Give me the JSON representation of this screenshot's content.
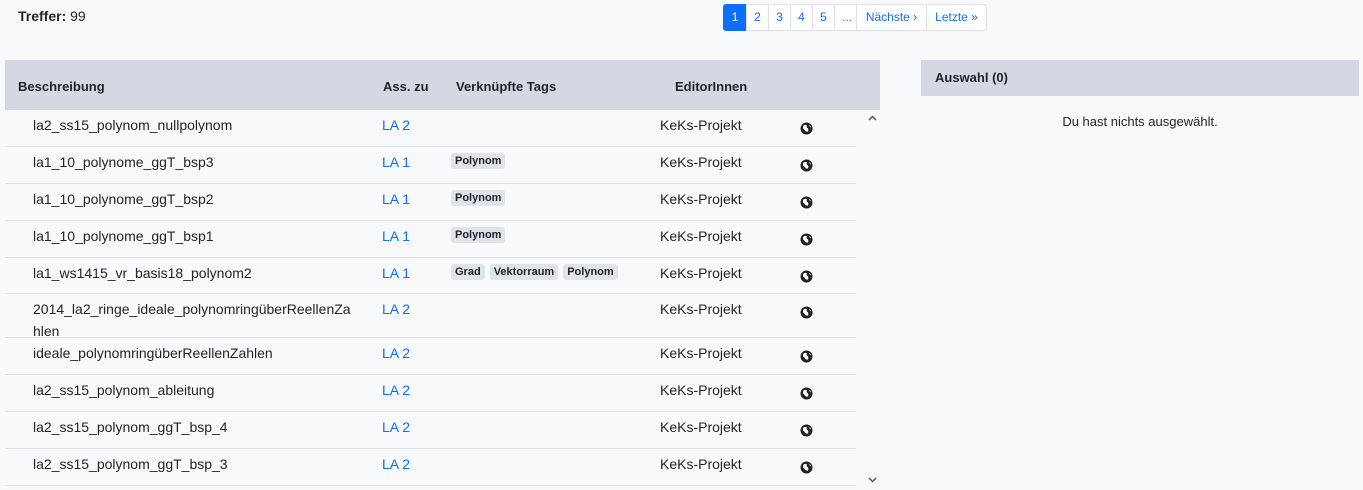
{
  "hits": {
    "label": "Treffer:",
    "count": "99"
  },
  "pagination": {
    "pages": [
      "1",
      "2",
      "3",
      "4",
      "5"
    ],
    "ellipsis": "...",
    "next": "Nächste ›",
    "last": "Letzte »",
    "active_page": "1"
  },
  "table": {
    "columns": {
      "description": "Beschreibung",
      "assigned": "Ass. zu",
      "tags": "Verknüpfte Tags",
      "editors": "EditorInnen"
    },
    "rows": [
      {
        "description": "la2_ss15_polynom_nullpolynom",
        "assigned": "LA 2",
        "tags": [],
        "editor": "KeKs-Projekt"
      },
      {
        "description": "la1_10_polynome_ggT_bsp3",
        "assigned": "LA 1",
        "tags": [
          "Polynom"
        ],
        "editor": "KeKs-Projekt"
      },
      {
        "description": "la1_10_polynome_ggT_bsp2",
        "assigned": "LA 1",
        "tags": [
          "Polynom"
        ],
        "editor": "KeKs-Projekt"
      },
      {
        "description": "la1_10_polynome_ggT_bsp1",
        "assigned": "LA 1",
        "tags": [
          "Polynom"
        ],
        "editor": "KeKs-Projekt"
      },
      {
        "description": "la1_ws1415_vr_basis18_polynom2",
        "assigned": "LA 1",
        "tags": [
          "Grad",
          "Vektorraum",
          "Polynom"
        ],
        "editor": "KeKs-Projekt"
      },
      {
        "description": "2014_la2_ringe_ideale_polynomringüberReellenZahlen",
        "assigned": "LA 2",
        "tags": [],
        "editor": "KeKs-Projekt"
      },
      {
        "description": "ideale_polynomringüberReellenZahlen",
        "assigned": "LA 2",
        "tags": [],
        "editor": "KeKs-Projekt"
      },
      {
        "description": "la2_ss15_polynom_ableitung",
        "assigned": "LA 2",
        "tags": [],
        "editor": "KeKs-Projekt"
      },
      {
        "description": "la2_ss15_polynom_ggT_bsp_4",
        "assigned": "LA 2",
        "tags": [],
        "editor": "KeKs-Projekt"
      },
      {
        "description": "la2_ss15_polynom_ggT_bsp_3",
        "assigned": "LA 2",
        "tags": [],
        "editor": "KeKs-Projekt"
      }
    ]
  },
  "selection": {
    "title": "Auswahl (0)",
    "empty_text": "Du hast nichts ausgewählt."
  },
  "icons": {
    "row_action": "globe-icon",
    "scroll_up": "chevron-up-icon",
    "scroll_down": "chevron-down-icon"
  },
  "colors": {
    "accent": "#0d6efd",
    "header_bg": "#d3d8e2",
    "tag_bg": "#dfe3ea"
  }
}
